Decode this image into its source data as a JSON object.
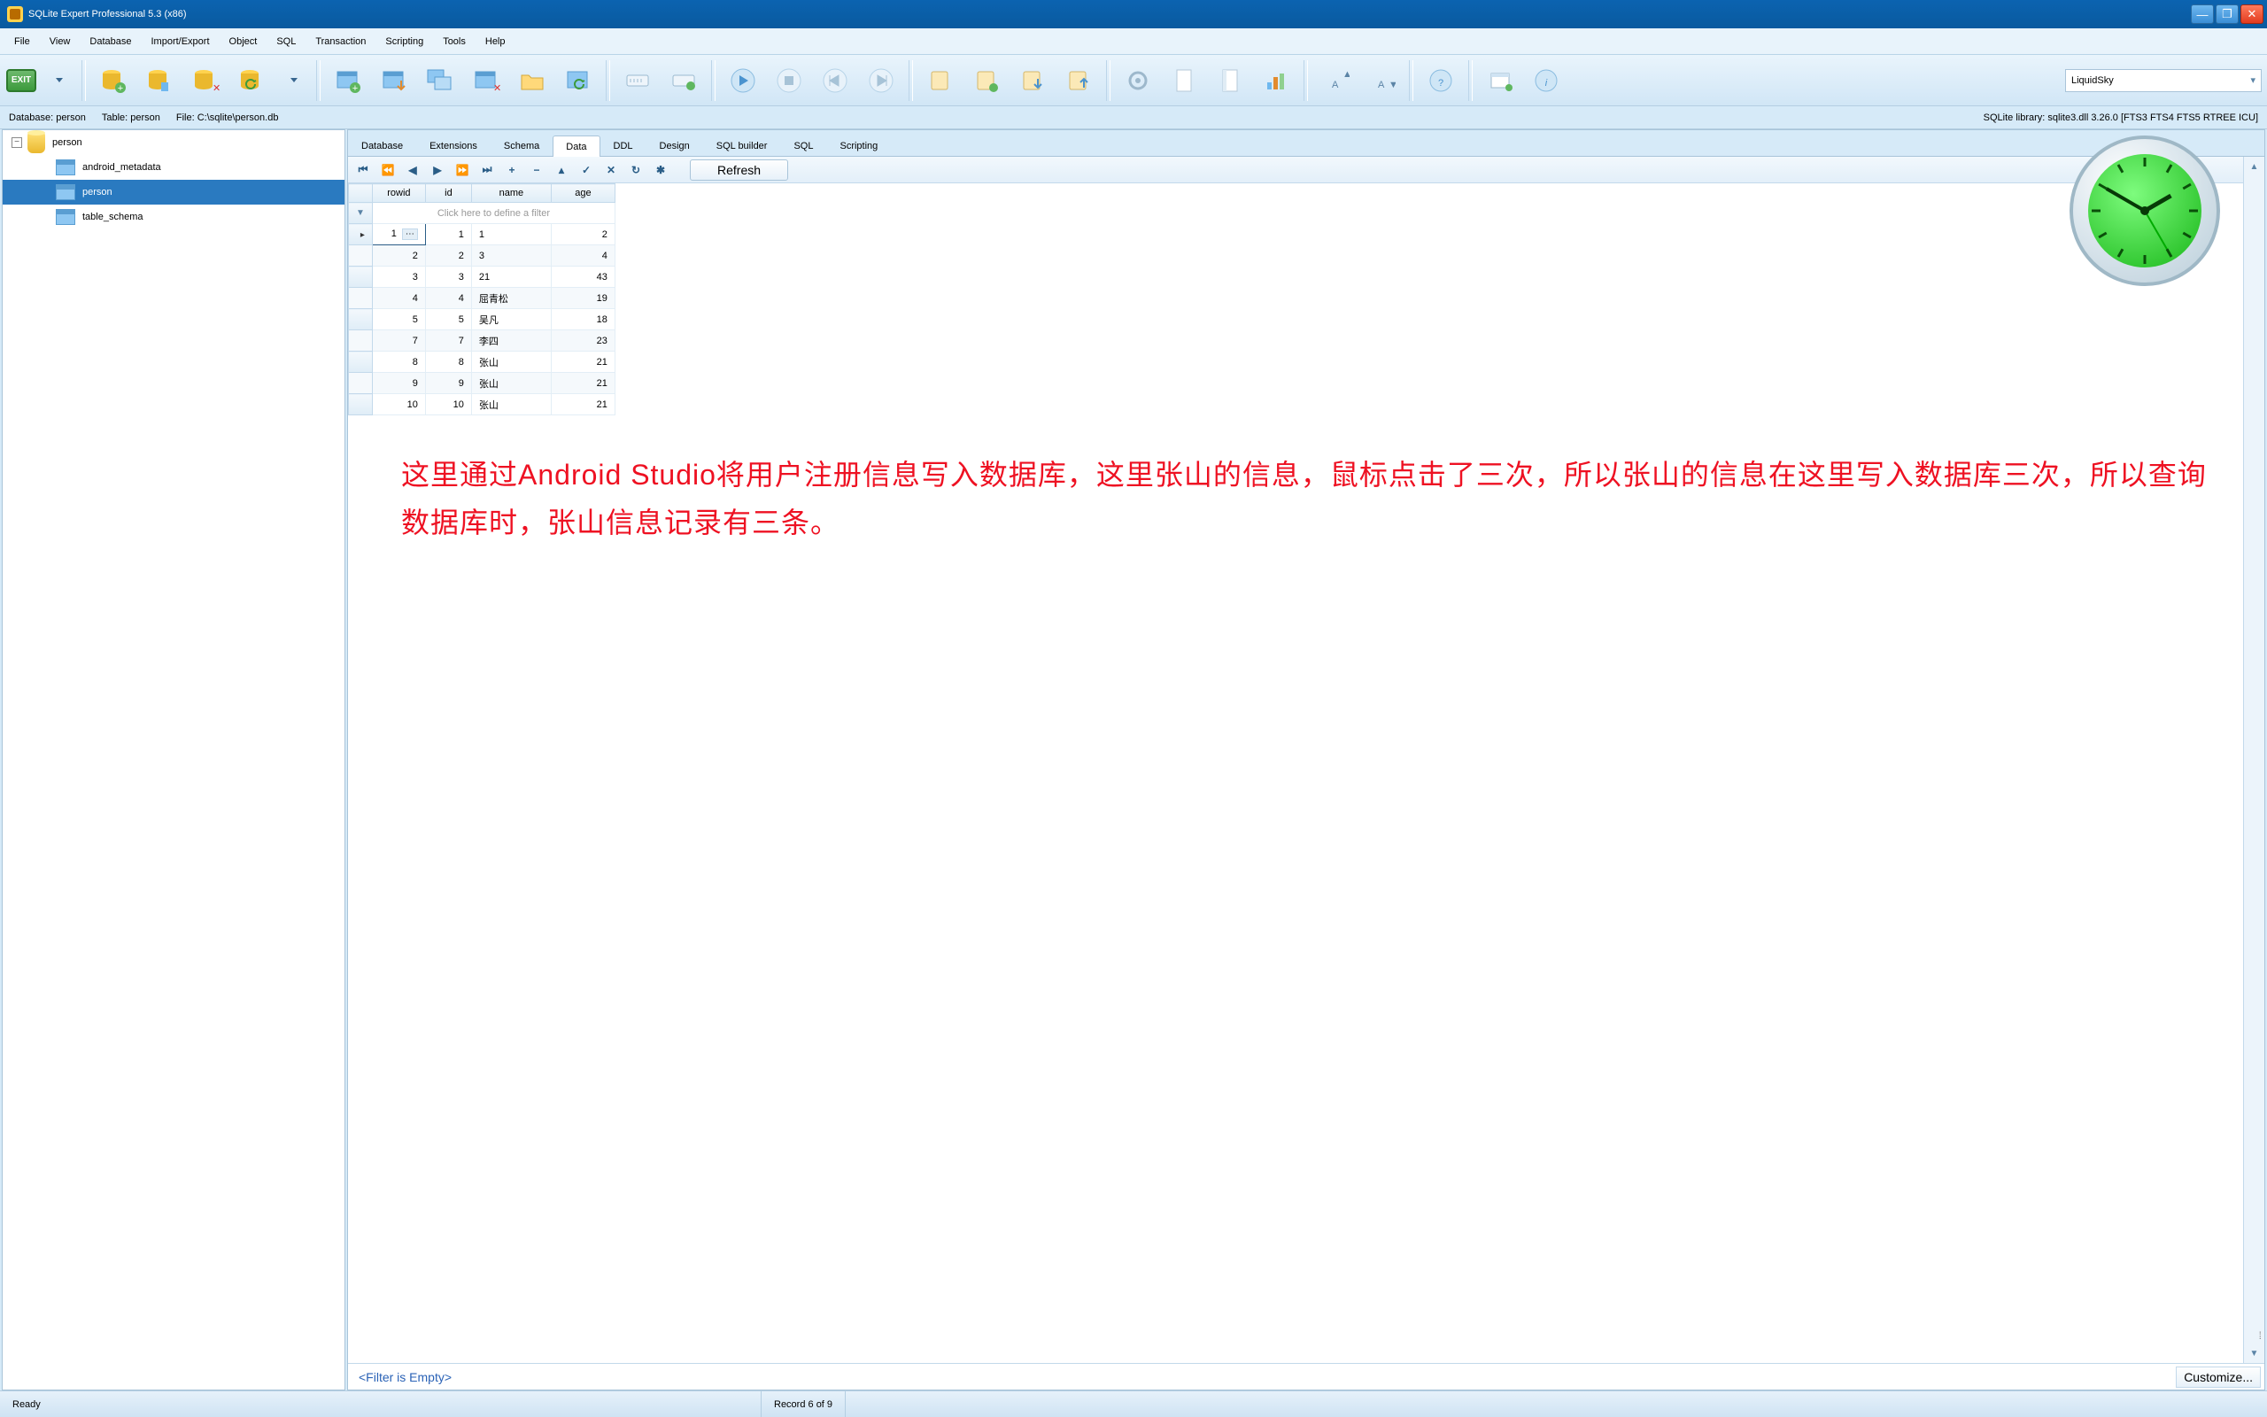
{
  "title": "SQLite Expert Professional 5.3 (x86)",
  "menus": [
    "File",
    "View",
    "Database",
    "Import/Export",
    "Object",
    "SQL",
    "Transaction",
    "Scripting",
    "Tools",
    "Help"
  ],
  "skin": "LiquidSky",
  "info": {
    "database": "Database: person",
    "table": "Table: person",
    "file": "File: C:\\sqlite\\person.db",
    "library": "SQLite library: sqlite3.dll 3.26.0 [FTS3 FTS4 FTS5 RTREE ICU]"
  },
  "tree": {
    "root": "person",
    "children": [
      "android_metadata",
      "person",
      "table_schema"
    ],
    "selected": "person"
  },
  "tabs": [
    "Database",
    "Extensions",
    "Schema",
    "Data",
    "DDL",
    "Design",
    "SQL builder",
    "SQL",
    "Scripting"
  ],
  "active_tab": "Data",
  "refresh": "Refresh",
  "columns": [
    "rowid",
    "id",
    "name",
    "age"
  ],
  "filter_hint": "Click here to define a filter",
  "rows": [
    {
      "rowid": 1,
      "id": 1,
      "name": "1",
      "age": 2,
      "sel": true
    },
    {
      "rowid": 2,
      "id": 2,
      "name": "3",
      "age": 4
    },
    {
      "rowid": 3,
      "id": 3,
      "name": "21",
      "age": 43
    },
    {
      "rowid": 4,
      "id": 4,
      "name": "屈青松",
      "age": 19
    },
    {
      "rowid": 5,
      "id": 5,
      "name": "吴凡",
      "age": 18
    },
    {
      "rowid": 7,
      "id": 7,
      "name": "李四",
      "age": 23
    },
    {
      "rowid": 8,
      "id": 8,
      "name": "张山",
      "age": 21
    },
    {
      "rowid": 9,
      "id": 9,
      "name": "张山",
      "age": 21
    },
    {
      "rowid": 10,
      "id": 10,
      "name": "张山",
      "age": 21
    }
  ],
  "annotation": "这里通过Android Studio将用户注册信息写入数据库，这里张山的信息，鼠标点击了三次，所以张山的信息在这里写入数据库三次，所以查询数据库时，张山信息记录有三条。",
  "filter_empty": "<Filter is Empty>",
  "customize": "Customize...",
  "status": {
    "ready": "Ready",
    "record": "Record 6 of 9"
  }
}
